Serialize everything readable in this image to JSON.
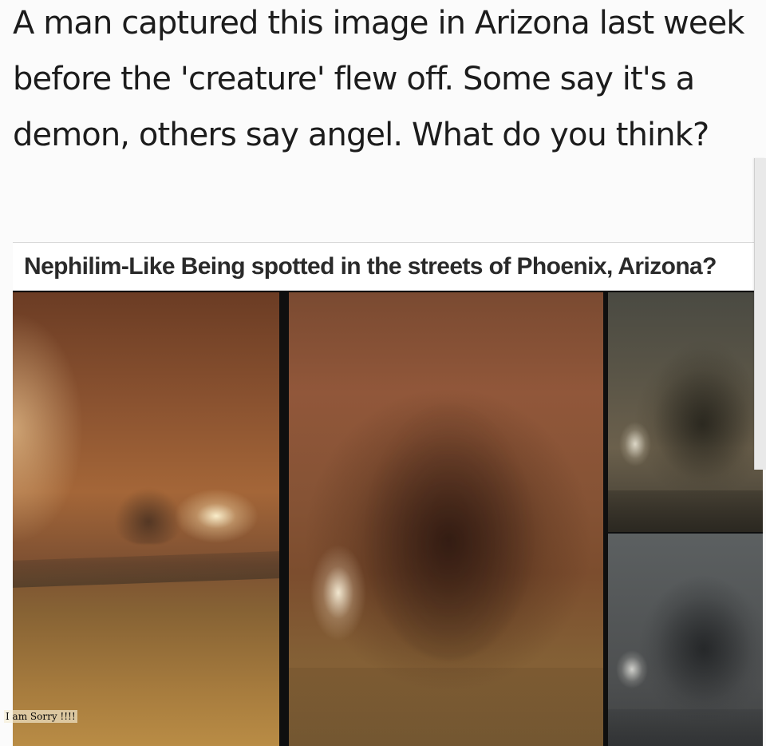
{
  "post": {
    "caption": "A man captured this image in Arizona last week before the 'creature' flew off. Some say it's a demon, others say angel. What do you think?"
  },
  "embedded_article": {
    "headline": "Nephilim-Like Being spotted in the streets of Phoenix, Arizona?"
  },
  "overlay": {
    "note": "I am Sorry !!!!"
  }
}
